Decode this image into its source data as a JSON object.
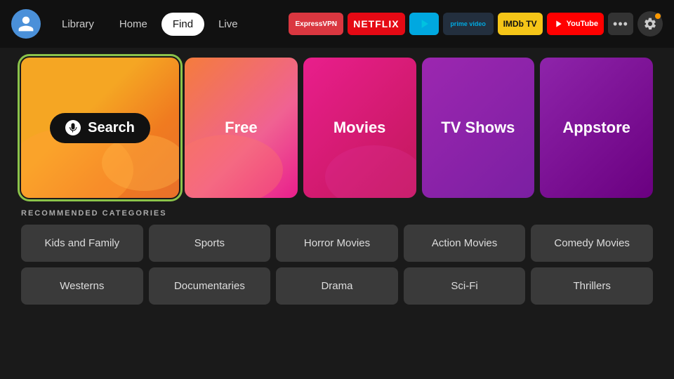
{
  "nav": {
    "links": [
      {
        "id": "library",
        "label": "Library",
        "active": false
      },
      {
        "id": "home",
        "label": "Home",
        "active": false
      },
      {
        "id": "find",
        "label": "Find",
        "active": true
      },
      {
        "id": "live",
        "label": "Live",
        "active": false
      }
    ],
    "apps": [
      {
        "id": "expressvpn",
        "label": "ExpressVPN"
      },
      {
        "id": "netflix",
        "label": "NETFLIX"
      },
      {
        "id": "freevee",
        "label": "▶"
      },
      {
        "id": "prime",
        "label": "prime video"
      },
      {
        "id": "imdb",
        "label": "IMDb TV"
      },
      {
        "id": "youtube",
        "label": "▶ YouTube"
      }
    ],
    "more_label": "•••",
    "settings_label": "⚙"
  },
  "tiles": [
    {
      "id": "search",
      "label": "Search",
      "type": "search"
    },
    {
      "id": "free",
      "label": "Free",
      "type": "free"
    },
    {
      "id": "movies",
      "label": "Movies",
      "type": "movies"
    },
    {
      "id": "tvshows",
      "label": "TV Shows",
      "type": "tvshows"
    },
    {
      "id": "appstore",
      "label": "Appstore",
      "type": "appstore"
    }
  ],
  "categories_section": {
    "title": "RECOMMENDED CATEGORIES",
    "rows": [
      [
        {
          "id": "kids-family",
          "label": "Kids and Family"
        },
        {
          "id": "sports",
          "label": "Sports"
        },
        {
          "id": "horror-movies",
          "label": "Horror Movies"
        },
        {
          "id": "action-movies",
          "label": "Action Movies"
        },
        {
          "id": "comedy-movies",
          "label": "Comedy Movies"
        }
      ],
      [
        {
          "id": "westerns",
          "label": "Westerns"
        },
        {
          "id": "documentaries",
          "label": "Documentaries"
        },
        {
          "id": "drama",
          "label": "Drama"
        },
        {
          "id": "sci-fi",
          "label": "Sci-Fi"
        },
        {
          "id": "thrillers",
          "label": "Thrillers"
        }
      ]
    ]
  }
}
